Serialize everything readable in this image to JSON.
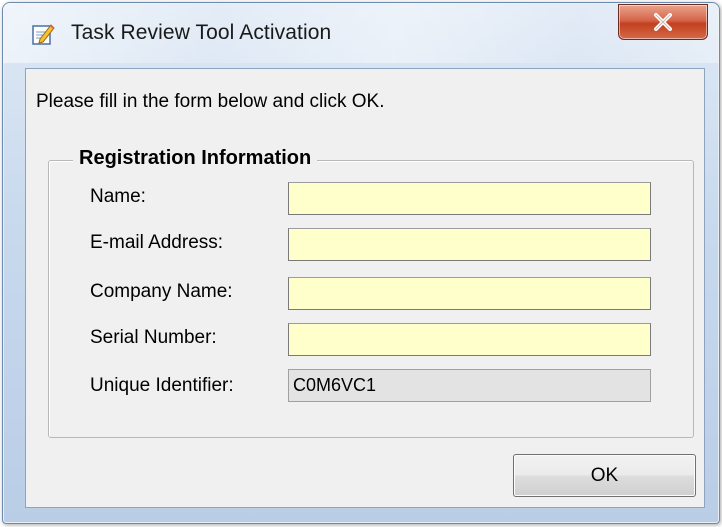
{
  "window": {
    "title": "Task Review Tool Activation",
    "icon": "notepad-pencil-icon",
    "close_icon": "close-x-icon"
  },
  "instruction": "Please fill in the form below and click OK.",
  "group": {
    "title": "Registration Information",
    "fields": [
      {
        "label": "Name:",
        "value": "",
        "readonly": false
      },
      {
        "label": "E-mail Address:",
        "value": "",
        "readonly": false
      },
      {
        "label": "Company Name:",
        "value": "",
        "readonly": false
      },
      {
        "label": "Serial Number:",
        "value": "",
        "readonly": false
      },
      {
        "label": "Unique Identifier:",
        "value": "C0M6VC1",
        "readonly": true
      }
    ]
  },
  "buttons": {
    "ok_label": "OK"
  },
  "colors": {
    "input_background": "#ffffcc",
    "readonly_background": "#e3e3e3",
    "close_button": "#c2401f",
    "frame": "#c9daee"
  }
}
